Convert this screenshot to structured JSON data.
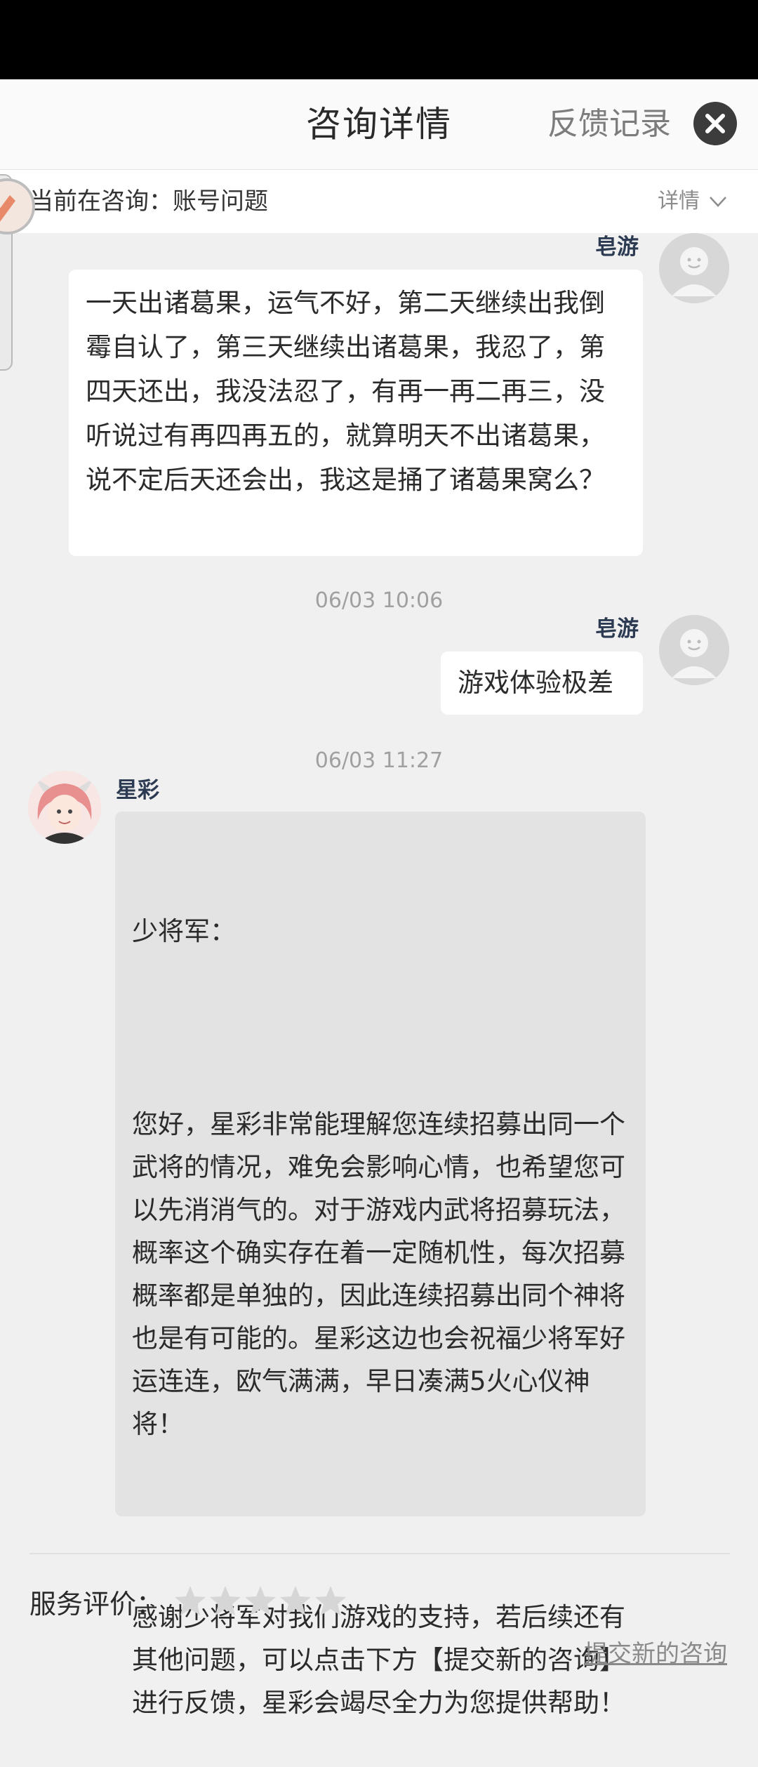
{
  "header": {
    "title": "咨询详情",
    "feedback_link": "反馈记录"
  },
  "subbar": {
    "current_label": "当前在咨询：账号问题",
    "detail_label": "详情"
  },
  "messages": [
    {
      "sender": "皂游",
      "text": "一天出诸葛果，运气不好，第二天继续出我倒霉自认了，第三天继续出诸葛果，我忍了，第四天还出，我没法忍了，有再一再二再三，没听说过有再四再五的，就算明天不出诸葛果，说不定后天还会出，我这是捅了诸葛果窝么？"
    },
    {
      "timestamp": "06/03 10:06",
      "sender": "皂游",
      "text": "游戏体验极差"
    },
    {
      "timestamp": "06/03 11:27",
      "sender": "星彩",
      "paragraphs": [
        "少将军：",
        "您好，星彩非常能理解您连续招募出同一个武将的情况，难免会影响心情，也希望您可以先消消气的。对于游戏内武将招募玩法，概率这个确实存在着一定随机性，每次招募概率都是单独的，因此连续招募出同个神将也是有可能的。星彩这边也会祝福少将军好运连连，欧气满满，早日凑满5火心仪神将！",
        "感谢少将军对我们游戏的支持，若后续还有其他问题，可以点击下方【提交新的咨询】进行反馈，星彩会竭尽全力为您提供帮助！"
      ]
    }
  ],
  "rating": {
    "label": "服务评价：",
    "stars": 0,
    "max_stars": 5
  },
  "submit_link": "提交新的咨询",
  "colors": {
    "header_bg": "#fafafa",
    "page_bg": "#f0f0f0",
    "agent_bubble": "#e3e3e3",
    "user_bubble": "#ffffff",
    "username": "#2d3b52",
    "star_empty": "#d6d6d6"
  },
  "icons": [
    "close-icon",
    "chevron-down-icon",
    "user-avatar-icon",
    "star-icon"
  ]
}
